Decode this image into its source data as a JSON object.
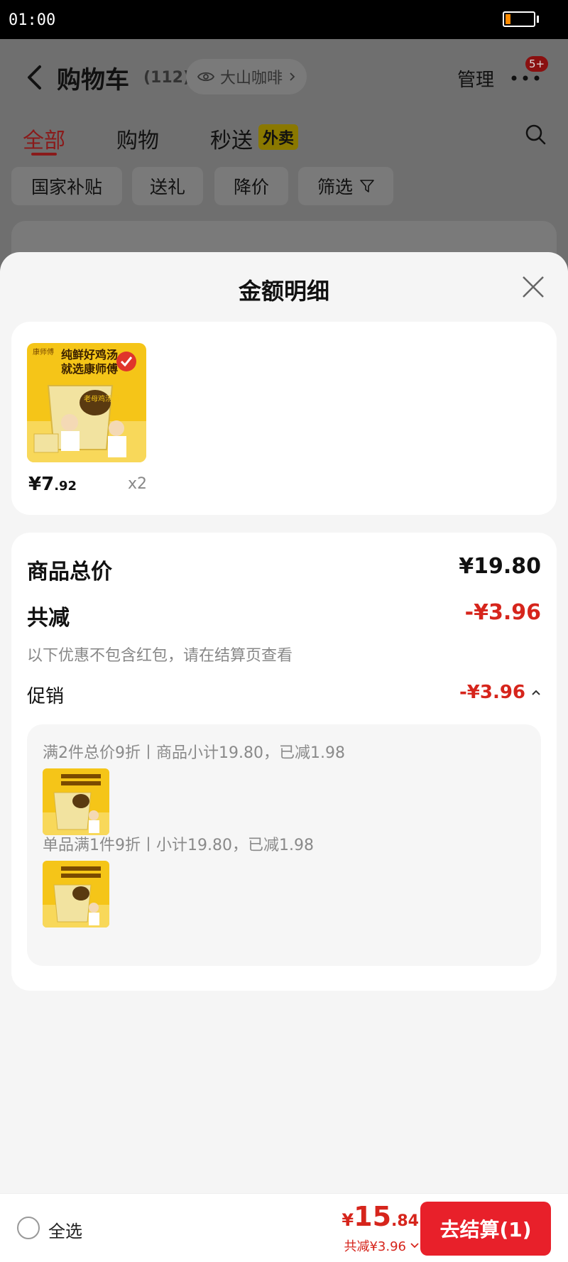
{
  "status_bar": {
    "time": "01:00"
  },
  "header": {
    "title": "购物车",
    "count": "(112)",
    "store": "大山咖啡",
    "manage": "管理",
    "badge": "5+"
  },
  "tabs": [
    {
      "label": "全部",
      "active": true
    },
    {
      "label": "购物",
      "active": false
    },
    {
      "label": "秒送",
      "badge": "外卖",
      "active": false
    }
  ],
  "filters": [
    "国家补贴",
    "送礼",
    "降价",
    "筛选"
  ],
  "sheet": {
    "title": "金额明细",
    "product": {
      "price_main": "¥7",
      "price_decimal": ".92",
      "quantity": "x2",
      "image_text_line1": "纯鲜好鸡汤",
      "image_text_line2": "就选康师傅",
      "image_logo": "康师傅",
      "image_seal": "老母鸡汤面"
    },
    "summary": {
      "total_label": "商品总价",
      "total_value": "¥19.80",
      "discount_label": "共减",
      "discount_value": "-¥3.96",
      "note": "以下优惠不包含红包，请在结算页查看",
      "promo_label": "促销",
      "promo_value": "-¥3.96",
      "promos": [
        {
          "text": "满2件总价9折丨商品小计19.80，已减1.98"
        },
        {
          "text": "单品满1件9折丨小计19.80，已减1.98"
        }
      ]
    }
  },
  "bottom_bar": {
    "select_all": "全选",
    "total_yen": "¥",
    "total_int": "15",
    "total_dec": ".84",
    "total_saved": "共减¥3.96",
    "checkout": "去结算(1)"
  },
  "colors": {
    "accent_red": "#e8202a",
    "price_red": "#d6251c",
    "product_yellow": "#f5c518"
  }
}
